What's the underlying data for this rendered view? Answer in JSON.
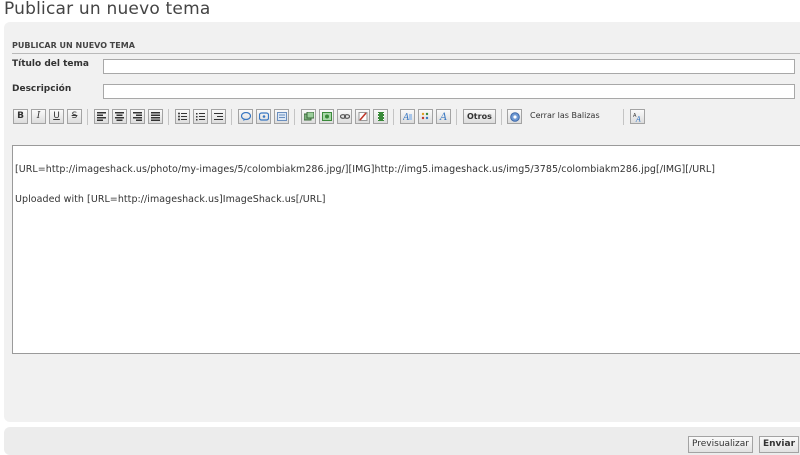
{
  "page": {
    "title": "Publicar un nuevo tema"
  },
  "form": {
    "section_header": "PUBLICAR UN NUEVO TEMA",
    "title_label": "Título del tema",
    "title_value": "",
    "description_label": "Descripción",
    "description_value": ""
  },
  "toolbar": {
    "bold": "B",
    "italic": "I",
    "underline": "U",
    "strike": "S",
    "otros": "Otros",
    "close_tags": "Cerrar las Balizas",
    "icons": [
      "bold-icon",
      "italic-icon",
      "underline-icon",
      "strikethrough-icon",
      "align-left-icon",
      "align-center-icon",
      "align-right-icon",
      "justify-icon",
      "unordered-list-icon",
      "ordered-list-icon",
      "indent-icon",
      "quote-icon",
      "code-icon",
      "php-icon",
      "image-icon",
      "media-icon",
      "link-icon",
      "pdf-icon",
      "film-icon",
      "font-size-icon",
      "color-icon",
      "font-icon",
      "help-icon",
      "spell-check-icon"
    ],
    "colors": {
      "accent_blue": "#3a78c2",
      "red": "#c0392b",
      "green": "#3a8a3a"
    }
  },
  "editor": {
    "lines": [
      "[URL=http://imageshack.us/photo/my-images/5/colombiakm286.jpg/][IMG]http://img5.imageshack.us/img5/3785/colombiakm286.jpg[/IMG][/URL]",
      "Uploaded with [URL=http://imageshack.us]ImageShack.us[/URL]"
    ]
  },
  "actions": {
    "preview": "Previsualizar",
    "submit": "Enviar"
  }
}
